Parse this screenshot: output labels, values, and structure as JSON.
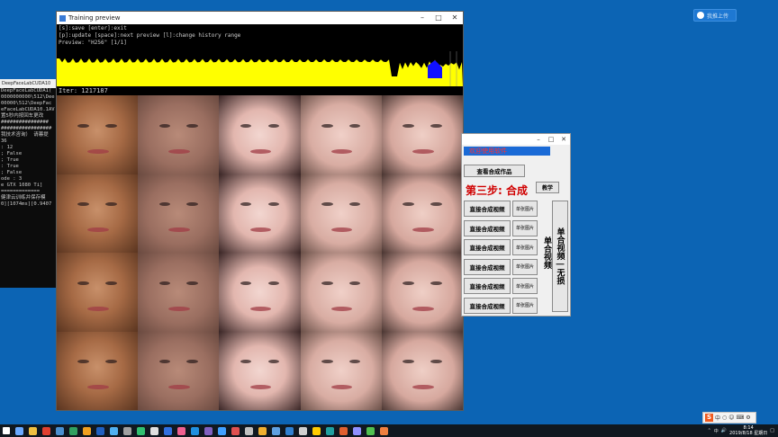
{
  "desktop": {
    "badge_text": "我推上传"
  },
  "console": {
    "title": "DeepFaceLabCUDA10",
    "lines": [
      "DeepFaceLabCUDA1(",
      "0000000000\\512\\Dee",
      "00000\\512\\DeepFac",
      "eFaceLabCUDA10.1AV",
      "",
      "",
      "置5秒内按回车更改",
      "################",
      "#################",
      "我技术咨询） 请暮提",
      "",
      "36",
      "",
      "",
      ": 12",
      "; False",
      "; True",
      ": True",
      "; False",
      "ode : 3",
      "",
      "e GTX 1080 Ti]",
      "=============",
      "健津云训练并保存模",
      "0][1074ms][0.9407"
    ]
  },
  "preview": {
    "title": "Training preview",
    "console_lines": [
      "[s]:save [enter]:exit",
      "[p]:update [space]:next preview [l]:change history range",
      "Preview: \"H256\" [1/1]"
    ],
    "iter_text": "Iter: 1217187"
  },
  "tool": {
    "banner_text": "欢迎使用软件",
    "view_button": "查看合成作品",
    "step_title": "第三步: 合成",
    "teach_button": "教学",
    "rows": [
      {
        "main": "直接合成视频",
        "side": "单张图片"
      },
      {
        "main": "直接合成视频",
        "side": "单张图片"
      },
      {
        "main": "直接合成视频",
        "side": "单张图片"
      },
      {
        "main": "直接合成视频",
        "side": "单张图片"
      },
      {
        "main": "直接合成视频",
        "side": "单张图片"
      },
      {
        "main": "直接合成视频",
        "side": "单张图片"
      }
    ],
    "vertical_label": "单合视频",
    "vertical_button": "单合视频 | 无损"
  },
  "taskbar": {
    "tray_ime": "中",
    "time": "8:14",
    "date": "2019/8/18 星期日"
  },
  "colors": {
    "desktop": "#0c64b4",
    "graph_yellow": "#ffff00",
    "graph_blue": "#1010ff",
    "banner_blue": "#1a6ad6",
    "step_red": "#d00000"
  }
}
